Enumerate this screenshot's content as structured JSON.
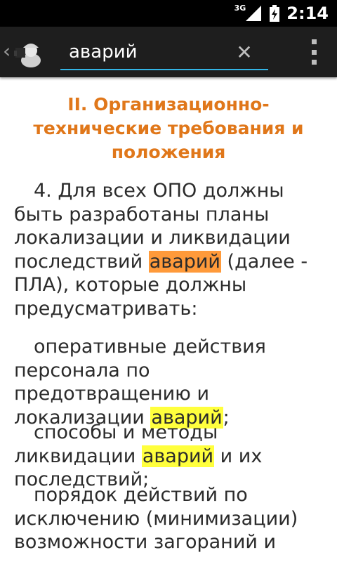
{
  "status_bar": {
    "network": "3G",
    "time": "2:14"
  },
  "action_bar": {
    "up_icon": "chevron-left-icon",
    "app_icon": "worker-helmet-icon",
    "search": {
      "value": "аварий",
      "accent_color": "#33b5e5"
    },
    "clear_icon": "close-icon",
    "overflow_icon": "overflow-menu-icon"
  },
  "document": {
    "section_title": "II. Организационно-технические требования и положения",
    "title_color": "#e0771a",
    "highlight_current_color": "#ff9a3a",
    "highlight_color": "#ffff3d",
    "paragraphs": [
      {
        "before": "4. Для всех ОПО должны быть разработаны планы локализации и ликвидации последствий ",
        "match": "аварий",
        "after": " (далее - ПЛА), которые должны предусматривать:"
      },
      {
        "before": "оперативные действия персонала по предотвращению и локализации ",
        "match": "аварий",
        "after": ";"
      },
      {
        "before": "способы и методы ликвидации ",
        "match": "аварий",
        "after": " и их последствий;"
      },
      {
        "before": "порядок действий по исключению (минимизации) возможности загораний и",
        "match": "",
        "after": ""
      }
    ]
  }
}
